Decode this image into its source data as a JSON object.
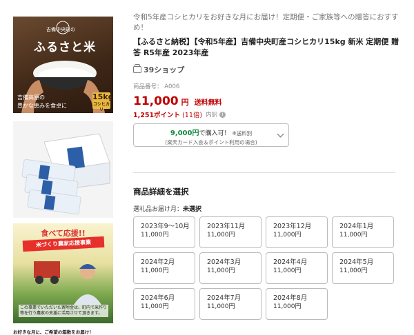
{
  "images": {
    "rice": {
      "sub_label": "吉備中央町の",
      "name": "ふるさと米",
      "bottom_text_1": "吉備高原の",
      "bottom_text_2": "豊かな恵みを食卓に",
      "badge_amount": "15kg",
      "badge_sub": "コシヒカリ"
    },
    "farmer": {
      "title": "食べて応援!!",
      "banner": "米づくり農家応援事業",
      "caption": "この事業でいただいた寄附金は、町内で米作り等を行う農家の支援に活用させて頂きます。"
    },
    "footnote": "お好きな月に、ご希望の箱数をお届け！"
  },
  "product": {
    "catch_copy": "令和5年産コシヒカリをお好きな月にお届け！定期便・ご家族等への贈答におすすめ！",
    "title": "【ふるさと納税】【令和5年産】吉備中央町産コシヒカリ15kg 新米 定期便 贈答 R5年産 2023年産",
    "shop_name": "39ショップ",
    "code_label": "商品番号：",
    "code": "A006",
    "price": "11,000",
    "price_unit": "円",
    "shipping": "送料無料",
    "points": "1,251ポイント",
    "point_multiplier": "(11倍)",
    "point_breakdown": "内訳",
    "card_price": "9,000円",
    "card_text": "で購入可！",
    "card_note": "※送料別",
    "card_sub": "(楽天カード入会＆ポイント利用の場合)"
  },
  "selection": {
    "heading": "商品詳細を選択",
    "label": "選礼品お届け月：",
    "status": "未選択",
    "options": [
      {
        "date": "2023年9～10月",
        "price": "11,000円"
      },
      {
        "date": "2023年11月",
        "price": "11,000円"
      },
      {
        "date": "2023年12月",
        "price": "11,000円"
      },
      {
        "date": "2024年1月",
        "price": "11,000円"
      },
      {
        "date": "2024年2月",
        "price": "11,000円"
      },
      {
        "date": "2024年3月",
        "price": "11,000円"
      },
      {
        "date": "2024年4月",
        "price": "11,000円"
      },
      {
        "date": "2024年5月",
        "price": "11,000円"
      },
      {
        "date": "2024年6月",
        "price": "11,000円"
      },
      {
        "date": "2024年7月",
        "price": "11,000円"
      },
      {
        "date": "2024年8月",
        "price": "11,000円"
      }
    ]
  },
  "colors": {
    "price_red": "#bf0000",
    "card_green": "#0d8a3c",
    "border": "#bbbbbb"
  }
}
